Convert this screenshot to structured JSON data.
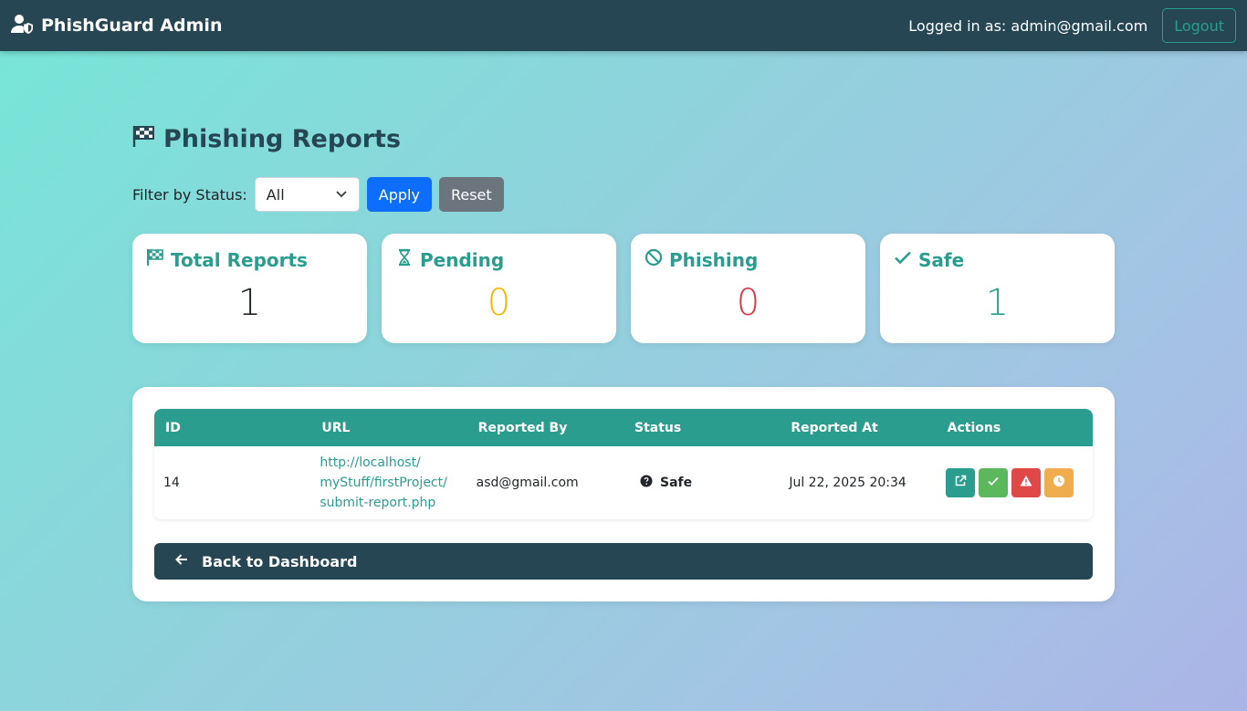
{
  "nav": {
    "brand": "PhishGuard Admin",
    "user_text": "Logged in as: admin@gmail.com",
    "logout_label": "Logout"
  },
  "page": {
    "title": "Phishing Reports"
  },
  "filter": {
    "label": "Filter by Status:",
    "selected": "All",
    "apply_label": "Apply",
    "reset_label": "Reset"
  },
  "stats": {
    "total": {
      "label": "Total Reports",
      "value": "1",
      "color": "#212529",
      "icon": "flag-checkered-icon"
    },
    "pending": {
      "label": "Pending",
      "value": "0",
      "color": "#f2b705",
      "icon": "hourglass-icon"
    },
    "phishing": {
      "label": "Phishing",
      "value": "0",
      "color": "#dc3545",
      "icon": "ban-icon"
    },
    "safe": {
      "label": "Safe",
      "value": "1",
      "color": "#2a9d8f",
      "icon": "check-icon"
    }
  },
  "table": {
    "headers": [
      "ID",
      "URL",
      "Reported By",
      "Status",
      "Reported At",
      "Actions"
    ],
    "rows": [
      {
        "id": "14",
        "url_lines": [
          "http://localhost/",
          "myStuff/firstProject/",
          "submit-report.php"
        ],
        "reported_by": "asd@gmail.com",
        "status": "Safe",
        "reported_at": "Jul 22, 2025 20:34"
      }
    ]
  },
  "back_label": "Back to Dashboard",
  "colors": {
    "navbar": "#264653",
    "accent": "#2a9d8f",
    "primary": "#0d6efd",
    "secondary": "#6c757d"
  }
}
